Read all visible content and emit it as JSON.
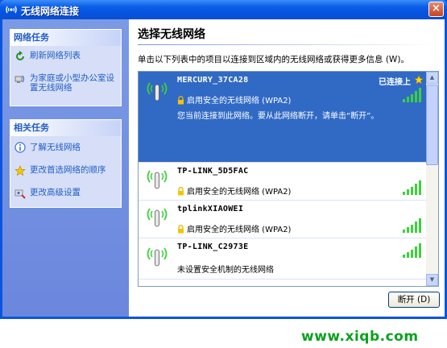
{
  "window": {
    "title": "无线网络连接",
    "close_label": "×"
  },
  "sidebar": {
    "network_tasks": {
      "title": "网络任务",
      "items": [
        {
          "label": "刷新网络列表",
          "icon": "refresh-icon"
        },
        {
          "label": "为家庭或小型办公室设置无线网络",
          "icon": "setup-network-icon"
        }
      ]
    },
    "related_tasks": {
      "title": "相关任务",
      "items": [
        {
          "label": "了解无线网络",
          "icon": "info-icon"
        },
        {
          "label": "更改首选网络的顺序",
          "icon": "star-icon"
        },
        {
          "label": "更改高级设置",
          "icon": "settings-icon"
        }
      ]
    }
  },
  "main": {
    "heading": "选择无线网络",
    "instruction": "单击以下列表中的项目以连接到区域内的无线网络或获得更多信息 (W)。",
    "networks": [
      {
        "ssid": "MERCURY_37CA28",
        "security": "启用安全的无线网络 (WPA2)",
        "status": "已连接上",
        "note": "您当前连接到此网络。要从此网络断开，请单击“断开”。",
        "signal_bars": 5,
        "selected": true
      },
      {
        "ssid": "TP-LINK_5D5FAC",
        "security": "启用安全的无线网络 (WPA2)",
        "signal_bars": 5,
        "selected": false
      },
      {
        "ssid": "tplinkXIAOWEI",
        "security": "启用安全的无线网络 (WPA2)",
        "signal_bars": 5,
        "selected": false
      },
      {
        "ssid": "TP-LINK_C2973E",
        "security": "未设置安全机制的无线网络",
        "signal_bars": 5,
        "selected": false
      }
    ],
    "disconnect_button": "断开 (D)"
  },
  "watermark": "www.xiqb.com",
  "colors": {
    "titlebar": "#0a55e0",
    "selected_row": "#316ac5",
    "sidebar": "#7a9ae6",
    "task_link": "#215dc6",
    "watermark": "#0aa21f"
  }
}
